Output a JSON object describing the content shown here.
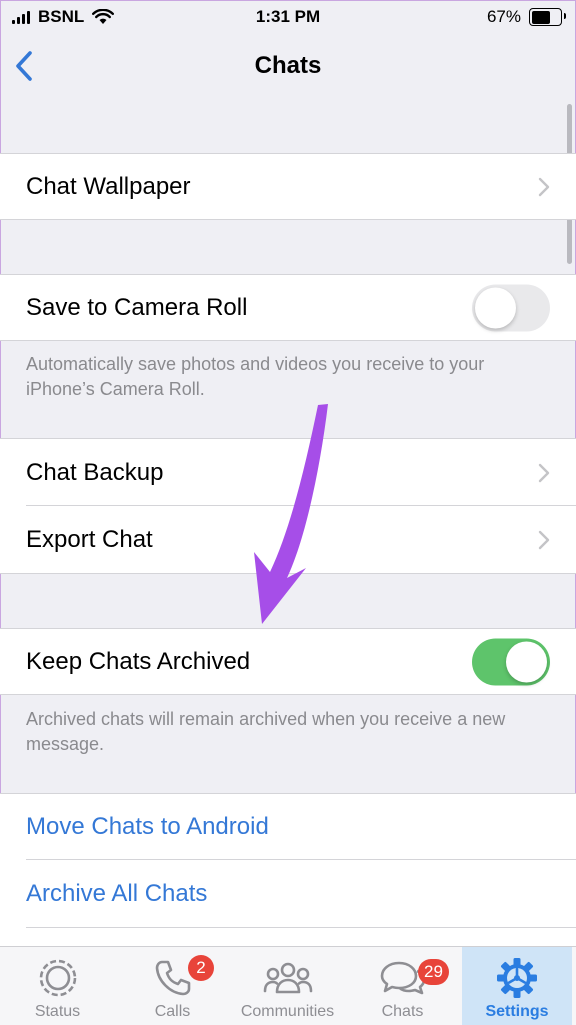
{
  "status_bar": {
    "carrier": "BSNL",
    "time": "1:31 PM",
    "battery": "67%",
    "battery_level": 0.67
  },
  "nav": {
    "back_icon": "chevron-left-icon",
    "title": "Chats"
  },
  "settings": {
    "chat_wallpaper": "Chat Wallpaper",
    "save_to_camera_roll": {
      "label": "Save to Camera Roll",
      "enabled": false,
      "footer": "Automatically save photos and videos you receive to your iPhone’s Camera Roll."
    },
    "chat_backup": "Chat Backup",
    "export_chat": "Export Chat",
    "keep_chats_archived": {
      "label": "Keep Chats Archived",
      "enabled": true,
      "footer": "Archived chats will remain archived when you receive a new message."
    },
    "move_chats_to_android": "Move Chats to Android",
    "archive_all_chats": "Archive All Chats"
  },
  "colors": {
    "accent": "#3478d6",
    "toggle_on": "#5ec46b",
    "arrow": "#a64ee8",
    "badge": "#e8443a"
  },
  "tab_bar": {
    "tabs": [
      {
        "label": "Status",
        "icon": "status-icon",
        "badge": null,
        "active": false
      },
      {
        "label": "Calls",
        "icon": "phone-icon",
        "badge": "2",
        "active": false
      },
      {
        "label": "Communities",
        "icon": "communities-icon",
        "badge": null,
        "active": false
      },
      {
        "label": "Chats",
        "icon": "chat-bubbles-icon",
        "badge": "29",
        "active": false
      },
      {
        "label": "Settings",
        "icon": "settings-gear-icon",
        "badge": null,
        "active": true
      }
    ]
  }
}
